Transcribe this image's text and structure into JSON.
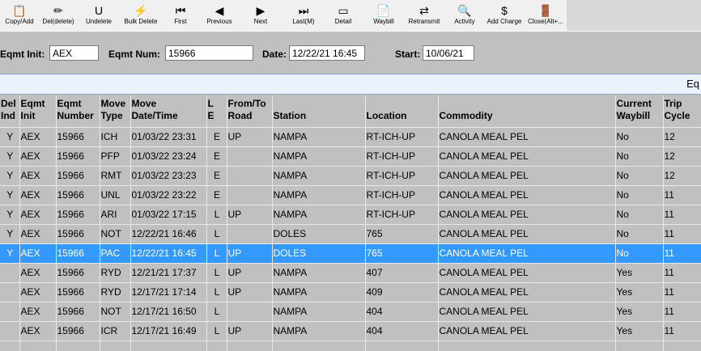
{
  "toolbar": {
    "buttons": [
      {
        "label": "Copy/Add",
        "icon": "📋"
      },
      {
        "label": "Del(delete)",
        "icon": "✏"
      },
      {
        "label": "Undelete",
        "icon": "U"
      },
      {
        "label": "Bulk Delete",
        "icon": "⚡"
      },
      {
        "label": "First",
        "icon": "⏮"
      },
      {
        "label": "Previous",
        "icon": "◀"
      },
      {
        "label": "Next",
        "icon": "▶"
      },
      {
        "label": "Last(M)",
        "icon": "⏭"
      },
      {
        "label": "Detail",
        "icon": "▭"
      },
      {
        "label": "Waybill",
        "icon": "📄"
      },
      {
        "label": "Retransmit",
        "icon": "⇄"
      },
      {
        "label": "Activity",
        "icon": "🔍"
      },
      {
        "label": "Add Charge",
        "icon": "$"
      },
      {
        "label": "Close(Alt+...",
        "icon": "🚪"
      }
    ]
  },
  "filters": {
    "eqmt_init_label": "Eqmt Init:",
    "eqmt_init_value": "AEX",
    "eqmt_num_label": "Eqmt Num:",
    "eqmt_num_value": "15966",
    "date_label": "Date:",
    "date_value": "12/22/21 16:45",
    "start_label": "Start:",
    "start_value": "10/06/21"
  },
  "banner": {
    "text": "Eq"
  },
  "table": {
    "headers": [
      {
        "l1": "Del",
        "l2": "Ind"
      },
      {
        "l1": "Eqmt",
        "l2": "Init"
      },
      {
        "l1": "Eqmt",
        "l2": "Number"
      },
      {
        "l1": "Move",
        "l2": "Type"
      },
      {
        "l1": "Move",
        "l2": "Date/Time"
      },
      {
        "l1": "L",
        "l2": "E"
      },
      {
        "l1": "From/To",
        "l2": "Road"
      },
      {
        "l1": "",
        "l2": "Station"
      },
      {
        "l1": "",
        "l2": "Location"
      },
      {
        "l1": "",
        "l2": "Commodity"
      },
      {
        "l1": "Current",
        "l2": "Waybill"
      },
      {
        "l1": "Trip",
        "l2": "Cycle"
      }
    ],
    "rows": [
      [
        "Y",
        "AEX",
        "15966",
        "ICH",
        "01/03/22 23:31",
        "E",
        "UP",
        "NAMPA",
        "RT-ICH-UP",
        "CANOLA MEAL PEL",
        "No",
        "12"
      ],
      [
        "Y",
        "AEX",
        "15966",
        "PFP",
        "01/03/22 23:24",
        "E",
        "",
        "NAMPA",
        "RT-ICH-UP",
        "CANOLA MEAL PEL",
        "No",
        "12"
      ],
      [
        "Y",
        "AEX",
        "15966",
        "RMT",
        "01/03/22 23:23",
        "E",
        "",
        "NAMPA",
        "RT-ICH-UP",
        "CANOLA MEAL PEL",
        "No",
        "12"
      ],
      [
        "Y",
        "AEX",
        "15966",
        "UNL",
        "01/03/22 23:22",
        "E",
        "",
        "NAMPA",
        "RT-ICH-UP",
        "CANOLA MEAL PEL",
        "No",
        "11"
      ],
      [
        "Y",
        "AEX",
        "15966",
        "ARI",
        "01/03/22 17:15",
        "L",
        "UP",
        "NAMPA",
        "RT-ICH-UP",
        "CANOLA MEAL PEL",
        "No",
        "11"
      ],
      [
        "Y",
        "AEX",
        "15966",
        "NOT",
        "12/22/21 16:46",
        "L",
        "",
        "DOLES",
        "765",
        "CANOLA MEAL PEL",
        "No",
        "11"
      ],
      [
        "Y",
        "AEX",
        "15966",
        "PAC",
        "12/22/21 16:45",
        "L",
        "UP",
        "DOLES",
        "765",
        "CANOLA MEAL PEL",
        "No",
        "11"
      ],
      [
        "",
        "AEX",
        "15966",
        "RYD",
        "12/21/21 17:37",
        "L",
        "UP",
        "NAMPA",
        "407",
        "CANOLA MEAL PEL",
        "Yes",
        "11"
      ],
      [
        "",
        "AEX",
        "15966",
        "RYD",
        "12/17/21 17:14",
        "L",
        "UP",
        "NAMPA",
        "409",
        "CANOLA MEAL PEL",
        "Yes",
        "11"
      ],
      [
        "",
        "AEX",
        "15966",
        "NOT",
        "12/17/21 16:50",
        "L",
        "",
        "NAMPA",
        "404",
        "CANOLA MEAL PEL",
        "Yes",
        "11"
      ],
      [
        "",
        "AEX",
        "15966",
        "ICR",
        "12/17/21 16:49",
        "L",
        "UP",
        "NAMPA",
        "404",
        "CANOLA MEAL PEL",
        "Yes",
        "11"
      ]
    ],
    "selected_row": 6
  },
  "colors": {
    "selection": "#3399ff",
    "background": "#c0c0c0",
    "banner": "#eaf2fc"
  }
}
